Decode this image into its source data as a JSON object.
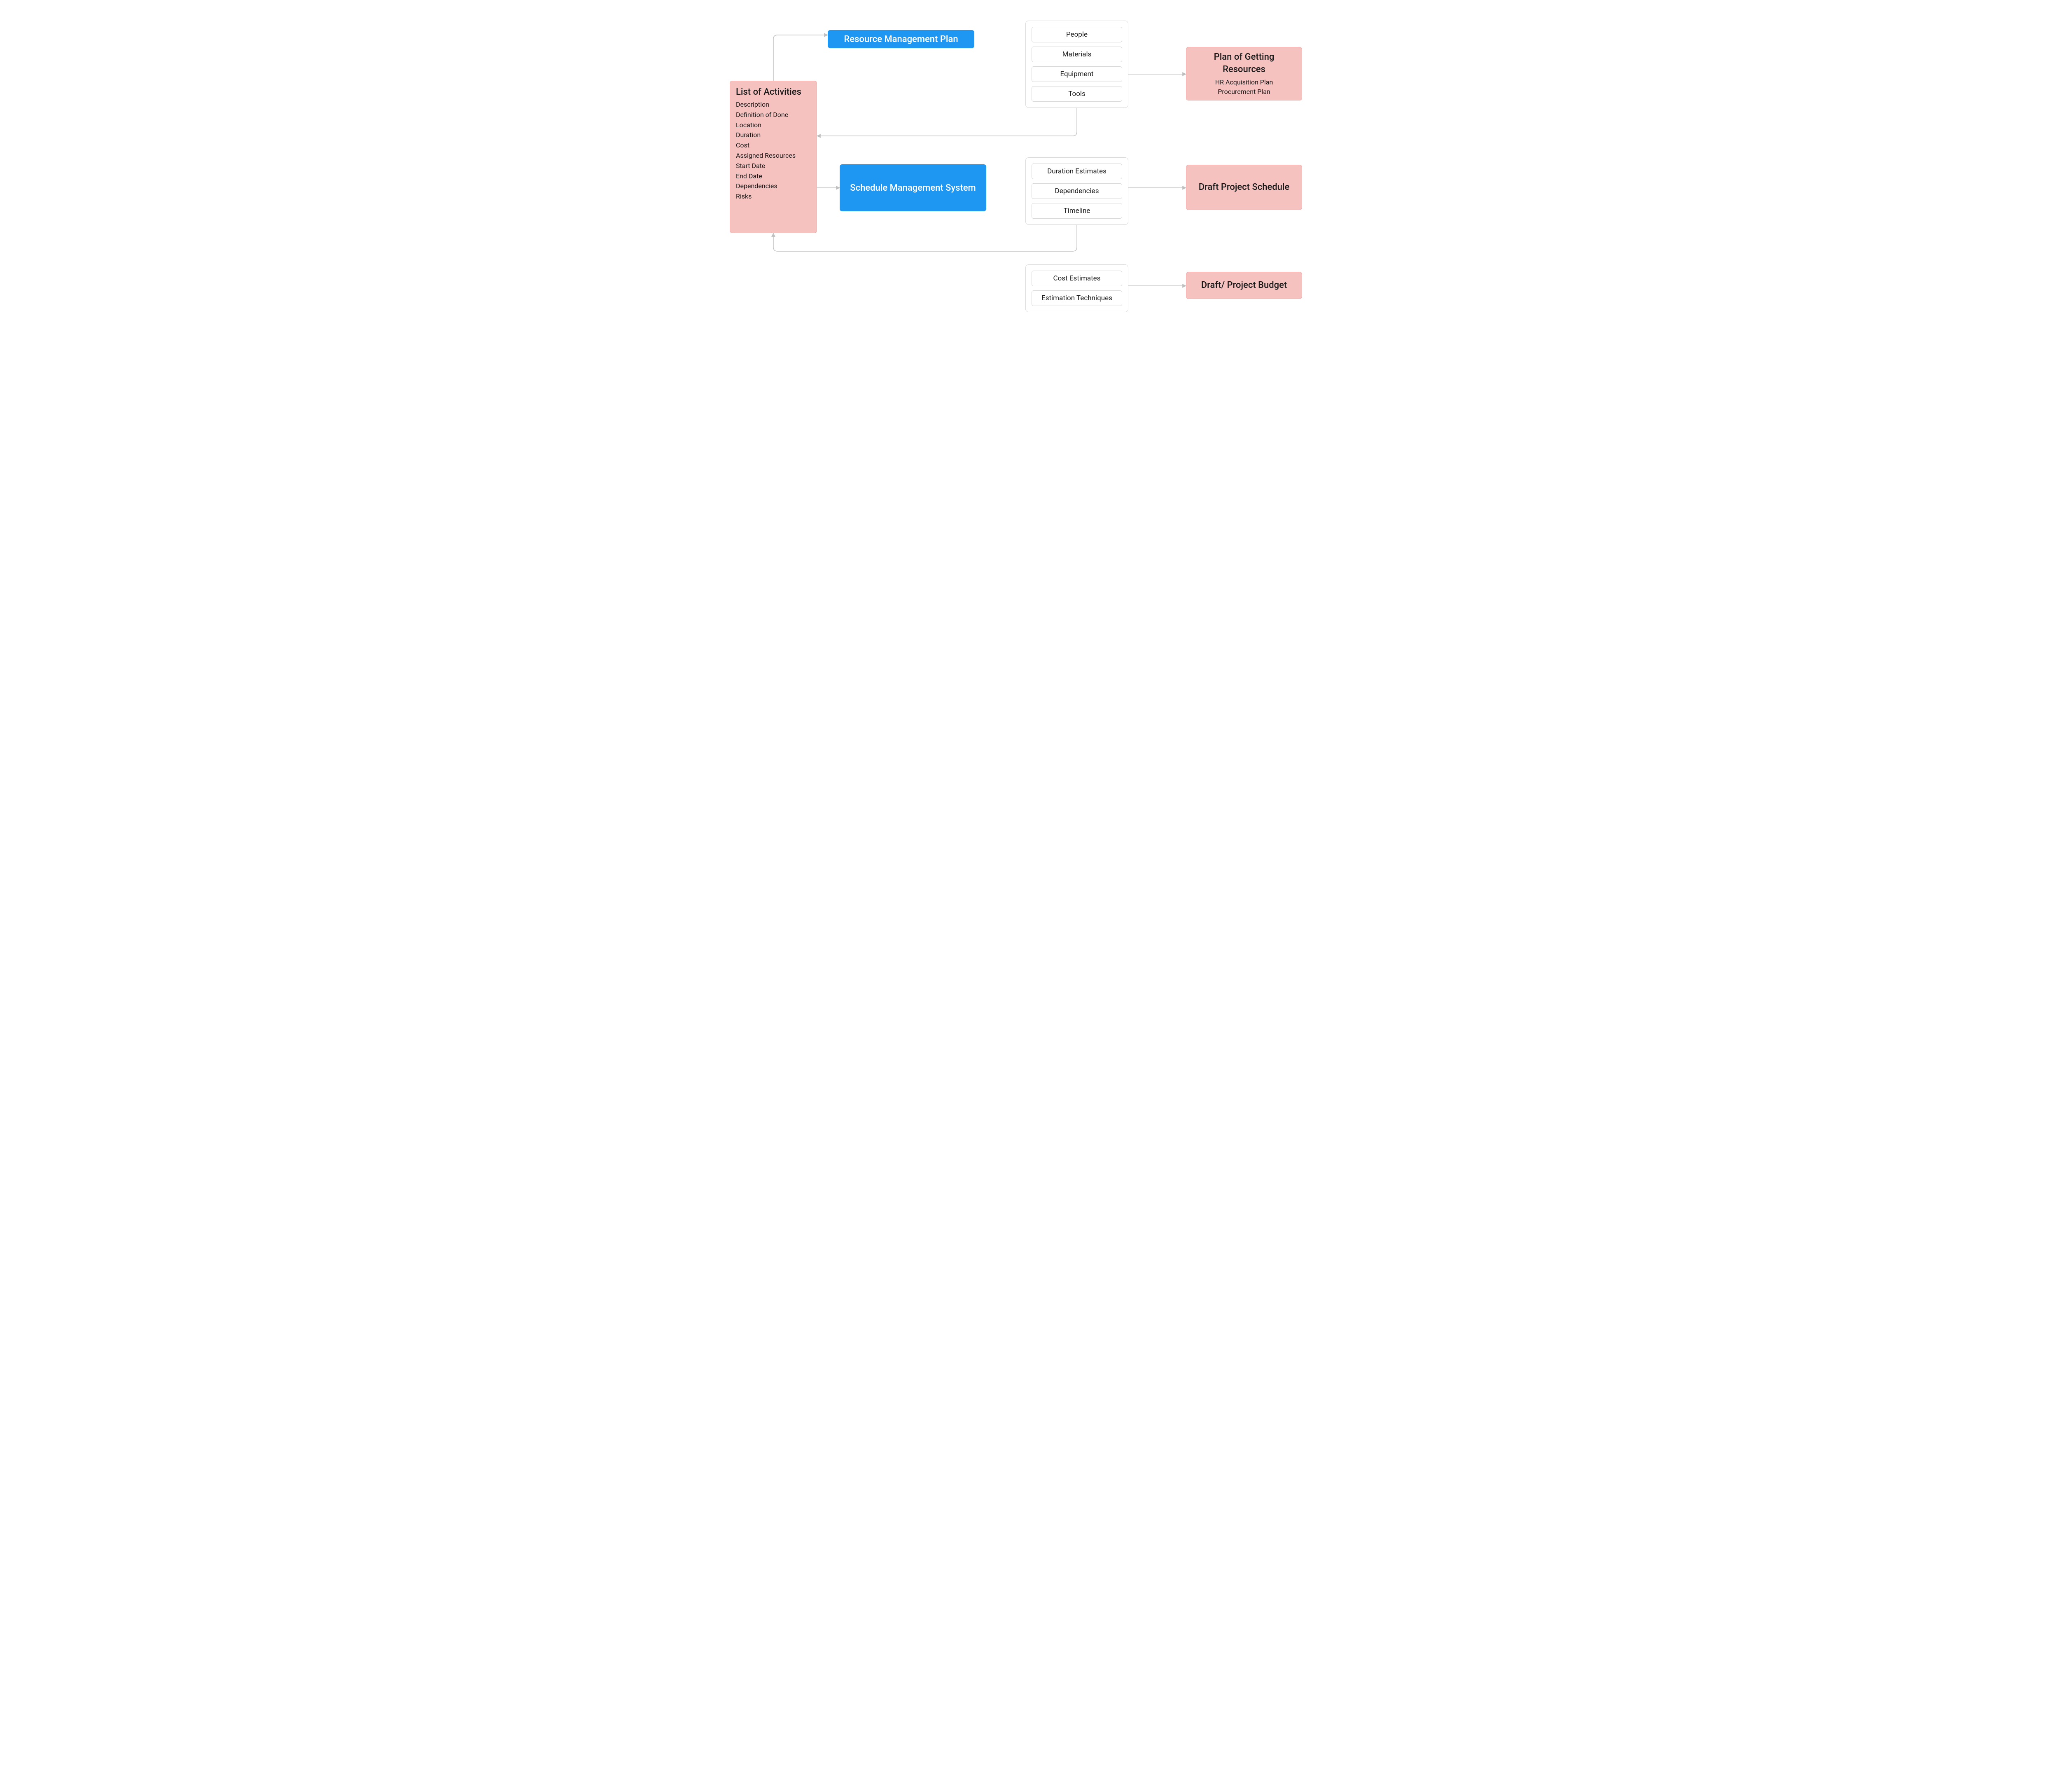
{
  "activities": {
    "title": "List of Activities",
    "items": [
      "Description",
      "Definition of Done",
      "Location",
      "Duration",
      "Cost",
      "Assigned Resources",
      "Start Date",
      "End Date",
      "Dependencies",
      "Risks"
    ]
  },
  "blue_nodes": {
    "rmp": "Resource Management Plan",
    "sms": "Schedule Management System"
  },
  "groups": {
    "resources": [
      "People",
      "Materials",
      "Equipment",
      "Tools"
    ],
    "schedule": [
      "Duration Estimates",
      "Dependencies",
      "Timeline"
    ],
    "cost": [
      "Cost Estimates",
      "Estimation Techniques"
    ]
  },
  "outputs": {
    "resources": {
      "title": "Plan of Getting Resources",
      "subs": [
        "HR Acquisition Plan",
        "Procurement Plan"
      ]
    },
    "schedule": {
      "title": "Draft Project Schedule"
    },
    "budget": {
      "title": "Draft/ Project Budget"
    }
  },
  "colors": {
    "pink_bg": "#f5c2c0",
    "blue_bg": "#1e97f3",
    "border_gray": "#d9d9d9",
    "connector": "#bfbfbf"
  }
}
